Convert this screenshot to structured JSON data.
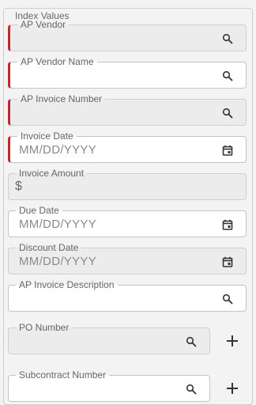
{
  "section": {
    "legend": "Index Values"
  },
  "fields": {
    "ap_vendor": {
      "label": "AP Vendor",
      "value": ""
    },
    "ap_vendor_name": {
      "label": "AP Vendor Name",
      "value": ""
    },
    "ap_invoice_number": {
      "label": "AP Invoice Number",
      "value": ""
    },
    "invoice_date": {
      "label": "Invoice Date",
      "placeholder": "MM/DD/YYYY"
    },
    "invoice_amount": {
      "label": "Invoice Amount",
      "prefix": "$"
    },
    "due_date": {
      "label": "Due Date",
      "placeholder": "MM/DD/YYYY"
    },
    "discount_date": {
      "label": "Discount Date",
      "placeholder": "MM/DD/YYYY"
    },
    "ap_invoice_description": {
      "label": "AP Invoice Description",
      "value": ""
    },
    "po_number": {
      "label": "PO Number",
      "value": ""
    },
    "subcontract_number": {
      "label": "Subcontract Number",
      "value": ""
    }
  },
  "icons": {
    "lookup": "search-icon",
    "date": "calendar-icon",
    "add": "plus-icon"
  },
  "colors": {
    "required_marker": "#c0282f",
    "disabled_bg": "#ececec",
    "enabled_bg": "#ffffff",
    "panel_bg": "#f3f3f3"
  }
}
